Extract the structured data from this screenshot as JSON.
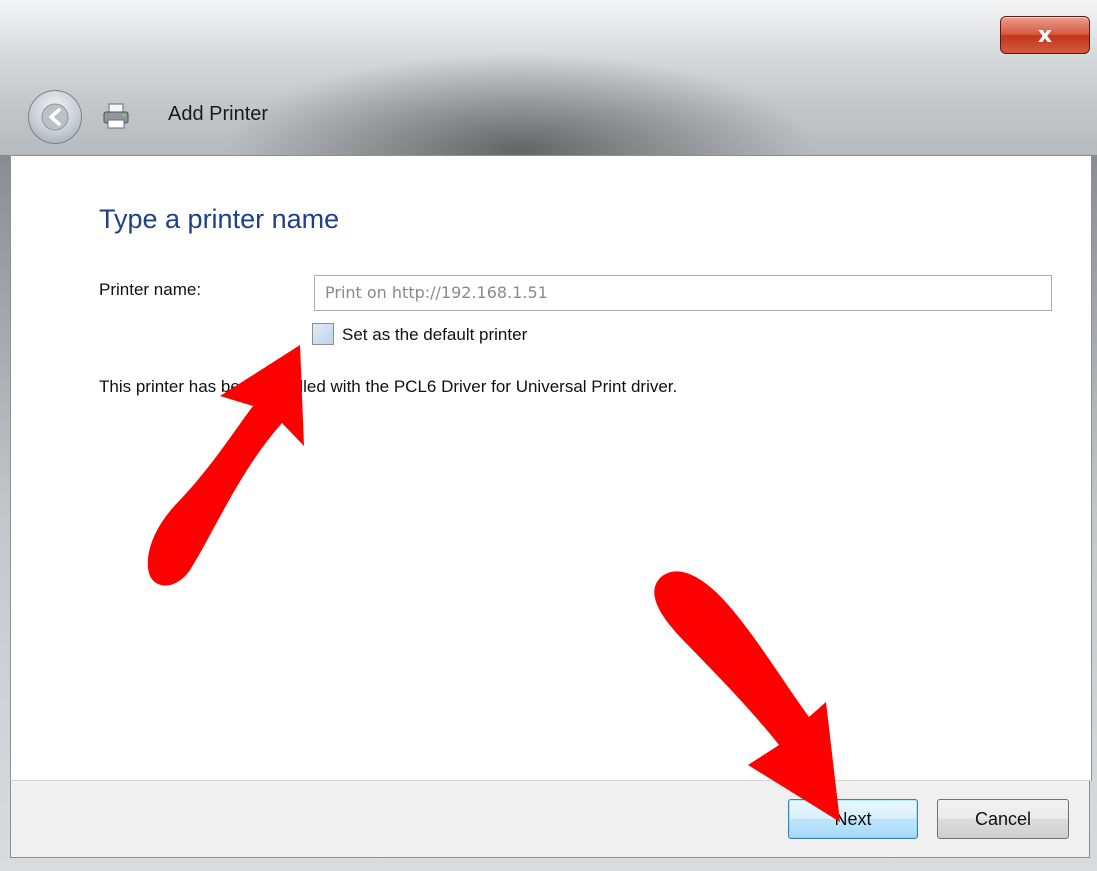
{
  "window": {
    "title": "Add Printer",
    "close_symbol": "x"
  },
  "icons": {
    "back": "back-arrow-icon",
    "printer": "printer-icon",
    "close": "close-icon"
  },
  "content": {
    "heading": "Type a printer name",
    "printer_name_label": "Printer name:",
    "printer_name_placeholder": "Print on http://192.168.1.51",
    "default_checkbox_label": "Set as the default printer",
    "default_checkbox_checked": false,
    "info_text": "This printer has been installed with the PCL6 Driver for Universal Print driver."
  },
  "footer": {
    "next_label": "Next",
    "cancel_label": "Cancel"
  },
  "colors": {
    "heading": "#1e3f8a",
    "annotation_arrow": "#ff0000",
    "close_button": "#c1361c"
  }
}
